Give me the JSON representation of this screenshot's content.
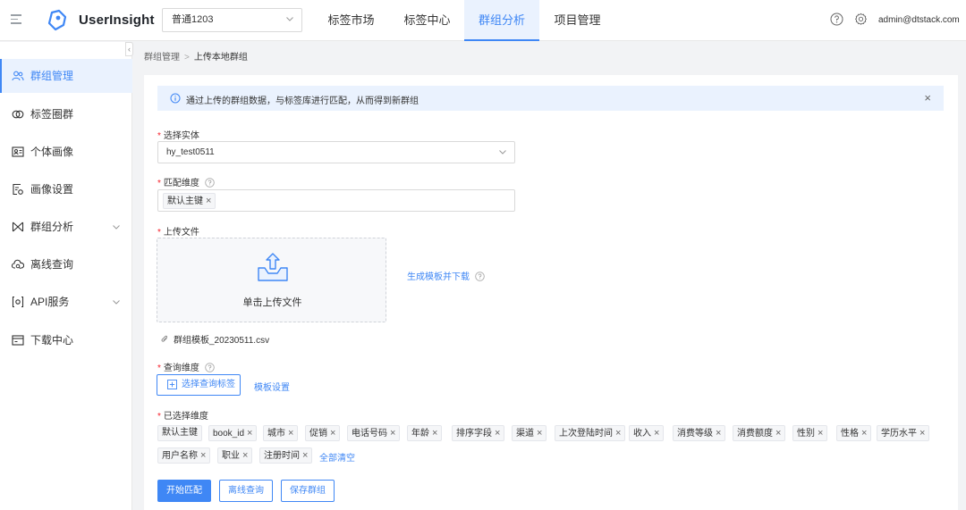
{
  "header": {
    "app_title": "UserInsight",
    "project": "普通1203",
    "tabs": [
      {
        "label": "标签市场",
        "active": false
      },
      {
        "label": "标签中心",
        "active": false
      },
      {
        "label": "群组分析",
        "active": true
      },
      {
        "label": "项目管理",
        "active": false
      }
    ],
    "user_email": "admin@dtstack.com",
    "icons": [
      "menu-icon",
      "logo-icon",
      "help-icon",
      "gear-icon"
    ]
  },
  "sidebar": {
    "items": [
      {
        "label": "群组管理",
        "icon": "group-icon",
        "active": true
      },
      {
        "label": "标签圈群",
        "icon": "circles-icon"
      },
      {
        "label": "个体画像",
        "icon": "portrait-icon"
      },
      {
        "label": "画像设置",
        "icon": "settings-doc-icon"
      },
      {
        "label": "群组分析",
        "icon": "analysis-icon",
        "expandable": true
      },
      {
        "label": "离线查询",
        "icon": "cloud-search-icon"
      },
      {
        "label": "API服务",
        "icon": "api-icon",
        "expandable": true
      },
      {
        "label": "下载中心",
        "icon": "download-icon"
      }
    ]
  },
  "breadcrumb": {
    "parent": "群组管理",
    "separator": ">",
    "current": "上传本地群组"
  },
  "alert": {
    "text": "通过上传的群组数据，与标签库进行匹配，从而得到新群组",
    "close": "×"
  },
  "form": {
    "entity": {
      "label": "选择实体",
      "value": "hy_test0511"
    },
    "match_dimension": {
      "label": "匹配维度",
      "chips": [
        "默认主键"
      ]
    },
    "upload": {
      "label": "上传文件",
      "prompt": "单击上传文件",
      "template_link": "生成模板并下载",
      "file_name": "群组模板_20230511.csv"
    },
    "query_dimension": {
      "label": "查询维度",
      "select_button": "选择查询标签",
      "template_settings": "模板设置"
    },
    "selected_dimensions": {
      "label": "已选择维度",
      "chips": [
        {
          "label": "默认主键",
          "removable": false
        },
        {
          "label": "book_id",
          "removable": true
        },
        {
          "label": "城市",
          "removable": true
        },
        {
          "label": "促销",
          "removable": true
        },
        {
          "label": "电话号码",
          "removable": true
        },
        {
          "label": "年龄",
          "removable": true
        },
        {
          "label": "排序字段",
          "removable": true
        },
        {
          "label": "渠道",
          "removable": true
        },
        {
          "label": "上次登陆时间",
          "removable": true
        },
        {
          "label": "收入",
          "removable": true
        },
        {
          "label": "消费等级",
          "removable": true
        },
        {
          "label": "消费额度",
          "removable": true
        },
        {
          "label": "性别",
          "removable": true
        },
        {
          "label": "性格",
          "removable": true
        },
        {
          "label": "学历水平",
          "removable": true
        },
        {
          "label": "用户名称",
          "removable": true
        },
        {
          "label": "职业",
          "removable": true
        },
        {
          "label": "注册时间",
          "removable": true
        }
      ],
      "clear_all": "全部清空"
    }
  },
  "actions": {
    "start_match": "开始匹配",
    "offline_query": "离线查询",
    "save_group": "保存群组"
  },
  "colors": {
    "primary": "#3f87f5",
    "active_bg": "#eaf2fe",
    "required": "#f5222d"
  }
}
